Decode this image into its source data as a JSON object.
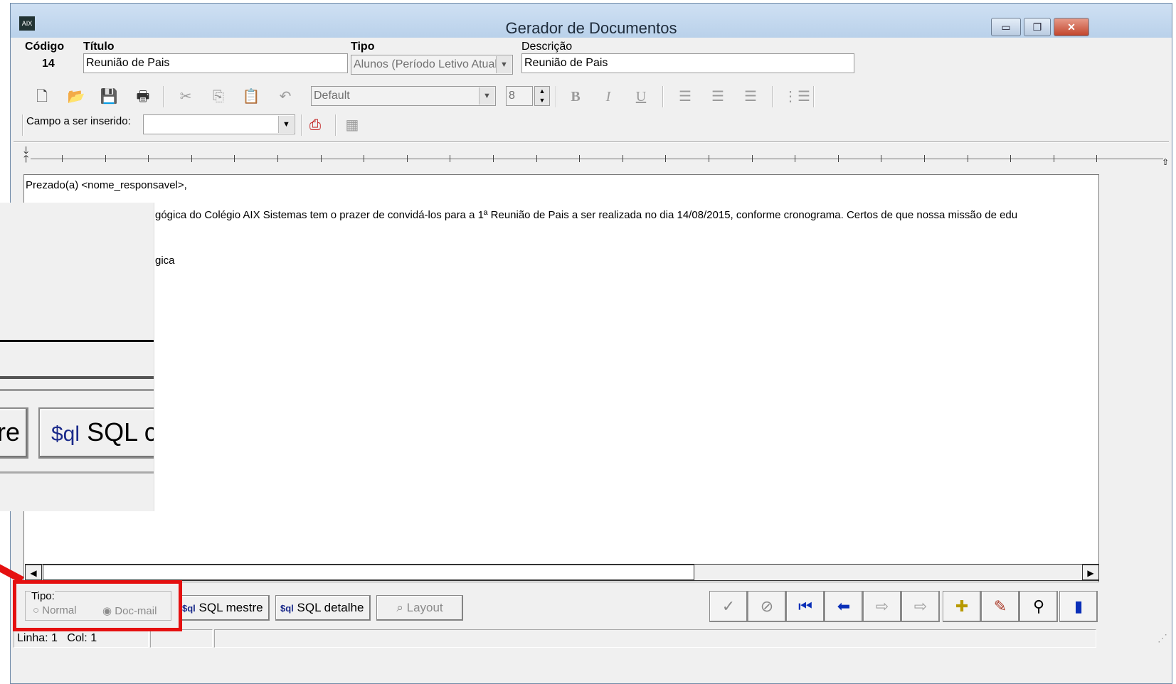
{
  "window": {
    "title": "Gerador de Documentos",
    "controls": {
      "minimize": "▭",
      "maximize": "❐",
      "close": "✕"
    }
  },
  "header": {
    "codigo_label": "Código",
    "codigo_value": "14",
    "titulo_label": "Título",
    "titulo_value": "Reunião de Pais",
    "tipo_label": "Tipo",
    "tipo_value": "Alunos (Período Letivo Atual)",
    "descricao_label": "Descrição",
    "descricao_value": "Reunião de Pais"
  },
  "toolbar": {
    "font_value": "Default",
    "size_value": "8",
    "campo_label": "Campo a ser inserido:",
    "campo_value": "",
    "icons": [
      "new-document-icon",
      "open-folder-icon",
      "save-icon",
      "print-icon",
      "cut-icon",
      "copy-icon",
      "paste-icon",
      "undo-icon",
      "bold-icon",
      "italic-icon",
      "underline-icon",
      "align-left-icon",
      "align-center-icon",
      "align-right-icon",
      "bullet-list-icon",
      "insert-field-icon",
      "insert-table-icon"
    ]
  },
  "editor": {
    "lines": [
      "Prezado(a) <nome_responsavel>,",
      "gógica do Colégio AIX Sistemas tem o prazer de convidá-los para a 1ª Reunião de Pais a ser realizada no dia 14/08/2015, conforme cronograma. Certos de que nossa missão de edu",
      "gica"
    ]
  },
  "bottom": {
    "tipo_label": "Tipo:",
    "radio_normal": "Normal",
    "radio_docmail": "Doc-mail",
    "sql_tag": "$ql",
    "sql_mestre": "SQL mestre",
    "sql_detalhe": "SQL detalhe",
    "layout": "Layout"
  },
  "status": {
    "linha_label": "Linha:",
    "linha_value": "1",
    "col_label": "Col:",
    "col_value": "1"
  },
  "zoom_inset": {
    "left_btn_text": "re",
    "right_btn_tag": "$ql",
    "right_btn_text": "SQL c"
  },
  "colors": {
    "highlight": "#e51010",
    "titlebar": "#b9d1ea",
    "nav_blue": "#0a2fb8"
  }
}
